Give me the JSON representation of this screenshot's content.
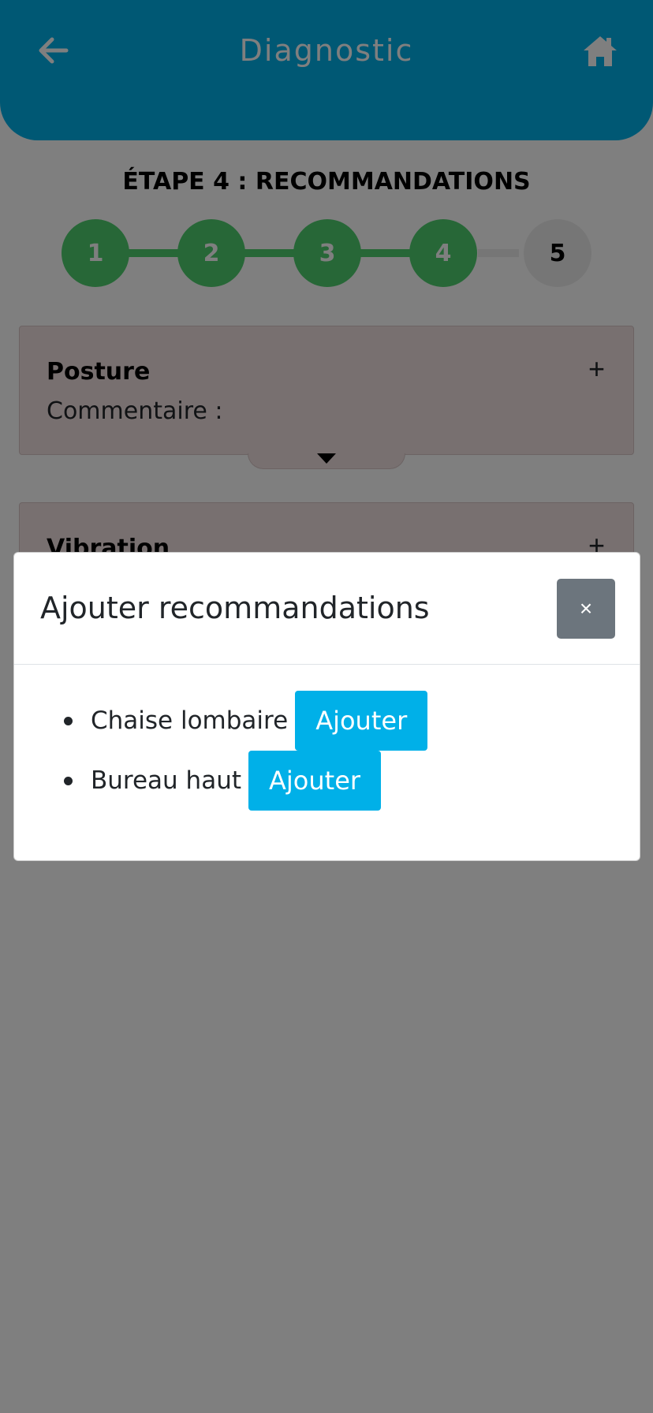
{
  "header": {
    "title": "Diagnostic",
    "back_icon": "arrow-left-icon",
    "home_icon": "home-icon",
    "background": "#00b0e8"
  },
  "step": {
    "title": "ÉTAPE 4 : RECOMMANDATIONS",
    "steps": [
      "1",
      "2",
      "3",
      "4",
      "5"
    ],
    "current": 4,
    "done_color": "#4fcf6f",
    "todo_color": "#ededed"
  },
  "cards": [
    {
      "title": "Posture",
      "comment_label": "Commentaire :",
      "plus": "+"
    },
    {
      "title": "Vibration",
      "plus": "+"
    }
  ],
  "modal": {
    "title": "Ajouter recommandations",
    "close_label": "×",
    "items": [
      {
        "label": "Chaise lombaire",
        "button": "Ajouter"
      },
      {
        "label": "Bureau haut",
        "button": "Ajouter"
      }
    ],
    "button_color": "#00b0e8",
    "close_color": "#6c757d"
  }
}
